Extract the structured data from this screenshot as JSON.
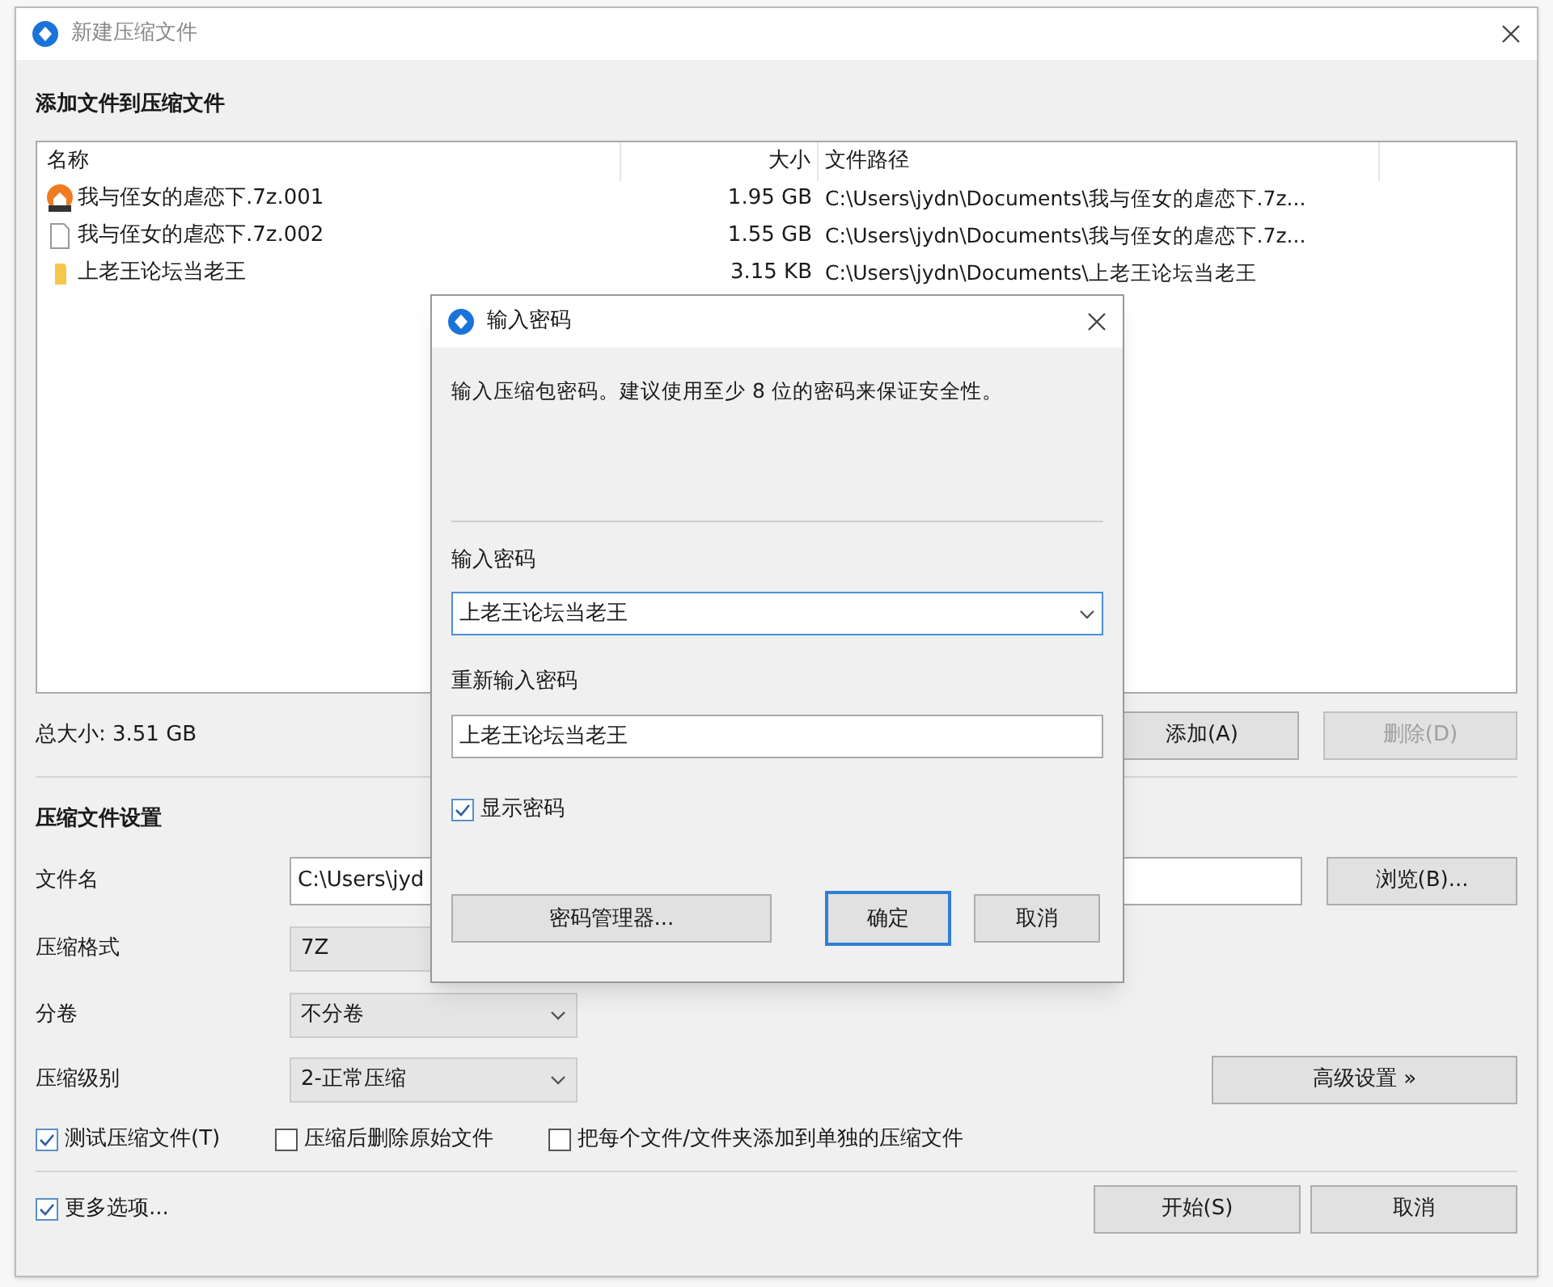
{
  "window": {
    "title": "新建压缩文件"
  },
  "add_section": {
    "title": "添加文件到压缩文件"
  },
  "file_list": {
    "columns": [
      "名称",
      "大小",
      "文件路径"
    ],
    "rows": [
      {
        "kind": "archive",
        "name": "我与侄女的虐恋下.7z.001",
        "size": "1.95 GB",
        "path": "C:\\Users\\jydn\\Documents\\我与侄女的虐恋下.7z..."
      },
      {
        "kind": "file",
        "name": "我与侄女的虐恋下.7z.002",
        "size": "1.55 GB",
        "path": "C:\\Users\\jydn\\Documents\\我与侄女的虐恋下.7z..."
      },
      {
        "kind": "folder",
        "name": "上老王论坛当老王",
        "size": "3.15 KB",
        "path": "C:\\Users\\jydn\\Documents\\上老王论坛当老王"
      }
    ]
  },
  "total": "总大小: 3.51 GB",
  "list_buttons": [
    {
      "label": "添加(A)",
      "disabled": false
    },
    {
      "label": "删除(D)",
      "disabled": true
    }
  ],
  "settings": {
    "title": "压缩文件设置",
    "filename": {
      "label": "文件名",
      "value": "C:\\Users\\jyd"
    },
    "browse": "浏览(B)...",
    "format": {
      "label": "压缩格式",
      "value": "7Z"
    },
    "split": {
      "label": "分卷",
      "value": "不分卷"
    },
    "level": {
      "label": "压缩级别",
      "value": "2-正常压缩"
    },
    "advanced": "高级设置 »"
  },
  "options": [
    {
      "label": "测试压缩文件(T)",
      "checked": true
    },
    {
      "label": "压缩后删除原始文件",
      "checked": false
    },
    {
      "label": "把每个文件/文件夹添加到单独的压缩文件",
      "checked": false
    }
  ],
  "more_options": {
    "label": "更多选项...",
    "checked": true
  },
  "footer_buttons": [
    "开始(S)",
    "取消"
  ],
  "dialog": {
    "title": "输入密码",
    "message": "输入压缩包密码。建议使用至少 8 位的密码来保证安全性。",
    "password_label": "输入密码",
    "password_value": "上老王论坛当老王",
    "confirm_label": "重新输入密码",
    "confirm_value": "上老王论坛当老王",
    "show_password": {
      "label": "显示密码",
      "checked": true
    },
    "buttons": [
      {
        "label": "密码管理器...",
        "kind": "wide"
      },
      {
        "label": "确定",
        "kind": "default"
      },
      {
        "label": "取消",
        "kind": "normal"
      }
    ]
  }
}
